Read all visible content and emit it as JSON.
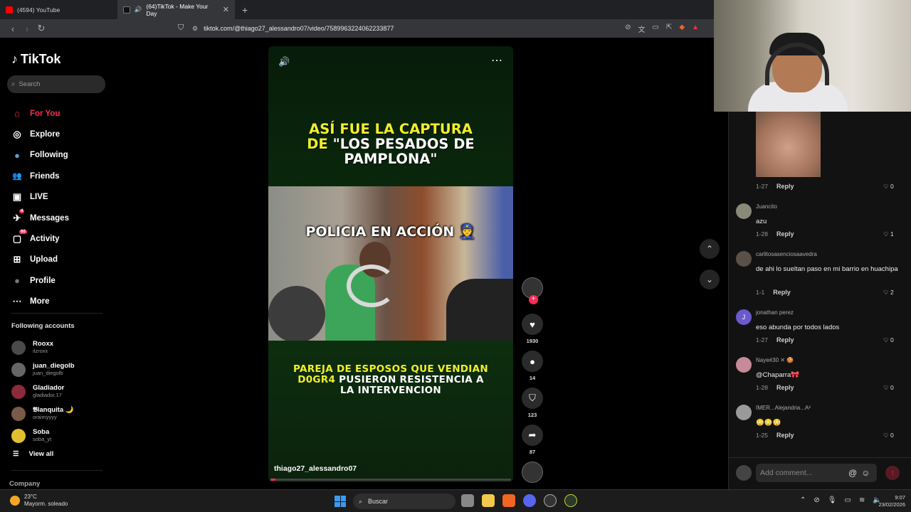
{
  "browser": {
    "tabs": [
      {
        "label": "(4594) YouTube",
        "color": "#ff0000"
      },
      {
        "label": "(64)TikTok - Make Your Day",
        "color": "#ffffff"
      }
    ],
    "new_tab": "+",
    "url": "tiktok.com/@thiago27_alessandro07/video/7589963224062233877"
  },
  "sidebar": {
    "logo": "TikTok",
    "search_placeholder": "Search",
    "nav": [
      {
        "label": "For You",
        "icon": "home-icon",
        "glyph": "⌂",
        "active": true
      },
      {
        "label": "Explore",
        "icon": "compass-icon",
        "glyph": "◎"
      },
      {
        "label": "Following",
        "icon": "following-avatar-icon",
        "glyph": "●"
      },
      {
        "label": "Friends",
        "icon": "friends-icon",
        "glyph": "👥"
      },
      {
        "label": "LIVE",
        "icon": "live-icon",
        "glyph": "▣"
      },
      {
        "label": "Messages",
        "icon": "messages-icon",
        "glyph": "✈",
        "badge": "4"
      },
      {
        "label": "Activity",
        "icon": "activity-icon",
        "glyph": "▢",
        "badge": "60"
      },
      {
        "label": "Upload",
        "icon": "upload-icon",
        "glyph": "⊞"
      },
      {
        "label": "Profile",
        "icon": "profile-icon",
        "glyph": "●"
      },
      {
        "label": "More",
        "icon": "more-icon",
        "glyph": "⋯"
      }
    ],
    "following_title": "Following accounts",
    "accounts": [
      {
        "name": "Rooxx",
        "handle": "ilzroxx"
      },
      {
        "name": "juan_diegolb",
        "handle": "juan_diegolb"
      },
      {
        "name": "Gladiador",
        "handle": "gladiador.17"
      },
      {
        "name": "𝕭lanquita 🌙",
        "handle": "oraimyyyy"
      },
      {
        "name": "Soba",
        "handle": "soba_yt"
      }
    ],
    "view_all": "View all",
    "company": "Company"
  },
  "video": {
    "headline_yellow": "ASÍ FUE LA CAPTURA",
    "headline_line2_yellow": "DE",
    "headline_line2_white": "\"LOS PESADOS DE",
    "headline_line3": "PAMPLONA\"",
    "clip_caption": "POLICIA EN ACCIÓN 👮",
    "sub_yellow1": "PAREJA DE ESPOSOS QUE VENDIAN",
    "sub_yellow2": "D0GR4",
    "sub_white2": "PUSIERON RESISTENCIA A",
    "sub_white3": "LA INTERVENCION",
    "author": "thiago27_alessandro07",
    "progress": 0.02
  },
  "actions": {
    "likes": "1930",
    "comments": "14",
    "saves": "123",
    "shares": "87"
  },
  "comments": {
    "first": {
      "date": "1-27",
      "reply": "Reply",
      "likes": "0"
    },
    "items": [
      {
        "user": "Juancito",
        "text": "azu",
        "date": "1-28",
        "reply": "Reply",
        "likes": "1",
        "avatar": ""
      },
      {
        "user": "carlitosasenciosaavedra",
        "text": "de ahi lo sueltan paso en mi barrio en huachipa",
        "date": "1-1",
        "reply": "Reply",
        "likes": "2",
        "avatar": ""
      },
      {
        "user": "jonathan perez",
        "text": "eso abunda por todos lados",
        "date": "1-27",
        "reply": "Reply",
        "likes": "0",
        "avatar": "J"
      },
      {
        "user": "Naye#30 ✕ 🍪",
        "text": "@Chaparra🎀",
        "date": "1-28",
        "reply": "Reply",
        "likes": "0",
        "avatar": ""
      },
      {
        "user": "IMER...Alejandria...A²",
        "text": "😳😳😳",
        "date": "1-25",
        "reply": "Reply",
        "likes": "0",
        "avatar": ""
      }
    ],
    "add_placeholder": "Add comment..."
  },
  "taskbar": {
    "temp": "23°C",
    "weather": "Mayorm. soleado",
    "search": "Buscar",
    "time": "9:07",
    "date": "23/02/2026"
  }
}
